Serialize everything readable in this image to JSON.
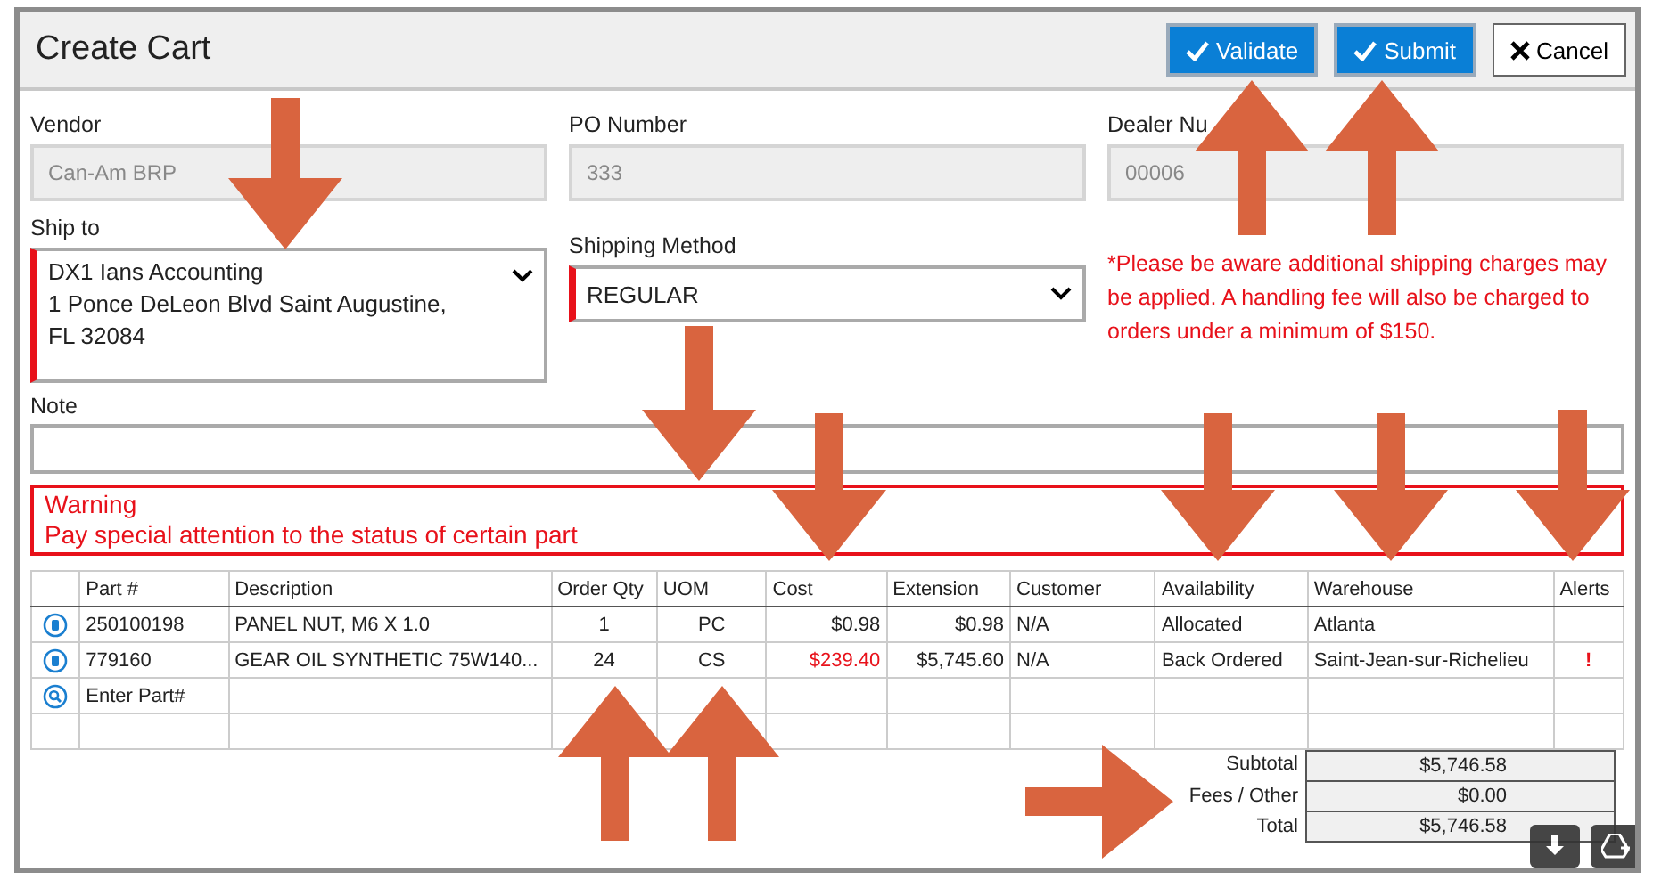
{
  "window": {
    "title": "Create Cart"
  },
  "buttons": [
    {
      "label": "Validate",
      "kind": "primary"
    },
    {
      "label": "Submit",
      "kind": "primary"
    },
    {
      "label": "Cancel",
      "kind": "cancel"
    }
  ],
  "fields": [
    {
      "label": "Vendor",
      "value": "Can-Am BRP"
    },
    {
      "label": "PO Number",
      "value": "333"
    },
    {
      "label": "Dealer Nu",
      "value": "00006"
    }
  ],
  "ship_to": {
    "label": "Ship to",
    "lines": [
      "DX1 Ians Accounting",
      "1 Ponce DeLeon Blvd Saint Augustine,",
      "FL 32084"
    ]
  },
  "shipping_method": {
    "label": "Shipping Method",
    "value": "REGULAR"
  },
  "shipping_notice": "*Please be aware additional shipping charges may be applied. A handling fee will also be charged to orders under a minimum of $150.",
  "note": {
    "label": "Note"
  },
  "warning": {
    "title": "Warning",
    "message": "Pay special attention to the status of certain part"
  },
  "table": {
    "columns": [
      "Part #",
      "Description",
      "Order Qty",
      "UOM",
      "Cost",
      "Extension",
      "Customer",
      "Availability",
      "Warehouse",
      "Alerts"
    ],
    "rows": [
      {
        "kind": "part",
        "cells": [
          "250100198",
          "PANEL NUT, M6 X 1.0",
          "1",
          "PC",
          "$0.98",
          "$0.98",
          "N/A",
          "Allocated",
          "Atlanta",
          ""
        ],
        "cost_warning": false
      },
      {
        "kind": "part",
        "cells": [
          "779160",
          "GEAR OIL SYNTHETIC 75W140...",
          "24",
          "CS",
          "$239.40",
          "$5,745.60",
          "N/A",
          "Back Ordered",
          "Saint-Jean-sur-Richelieu",
          "!"
        ],
        "cost_warning": true
      },
      {
        "kind": "entry",
        "placeholder": "Enter Part#"
      },
      {
        "kind": "empty"
      }
    ]
  },
  "totals": [
    {
      "label": "Subtotal",
      "value": "$5,746.58"
    },
    {
      "label": "Fees / Other",
      "value": "$0.00"
    },
    {
      "label": "Total",
      "value": "$5,746.58"
    }
  ]
}
